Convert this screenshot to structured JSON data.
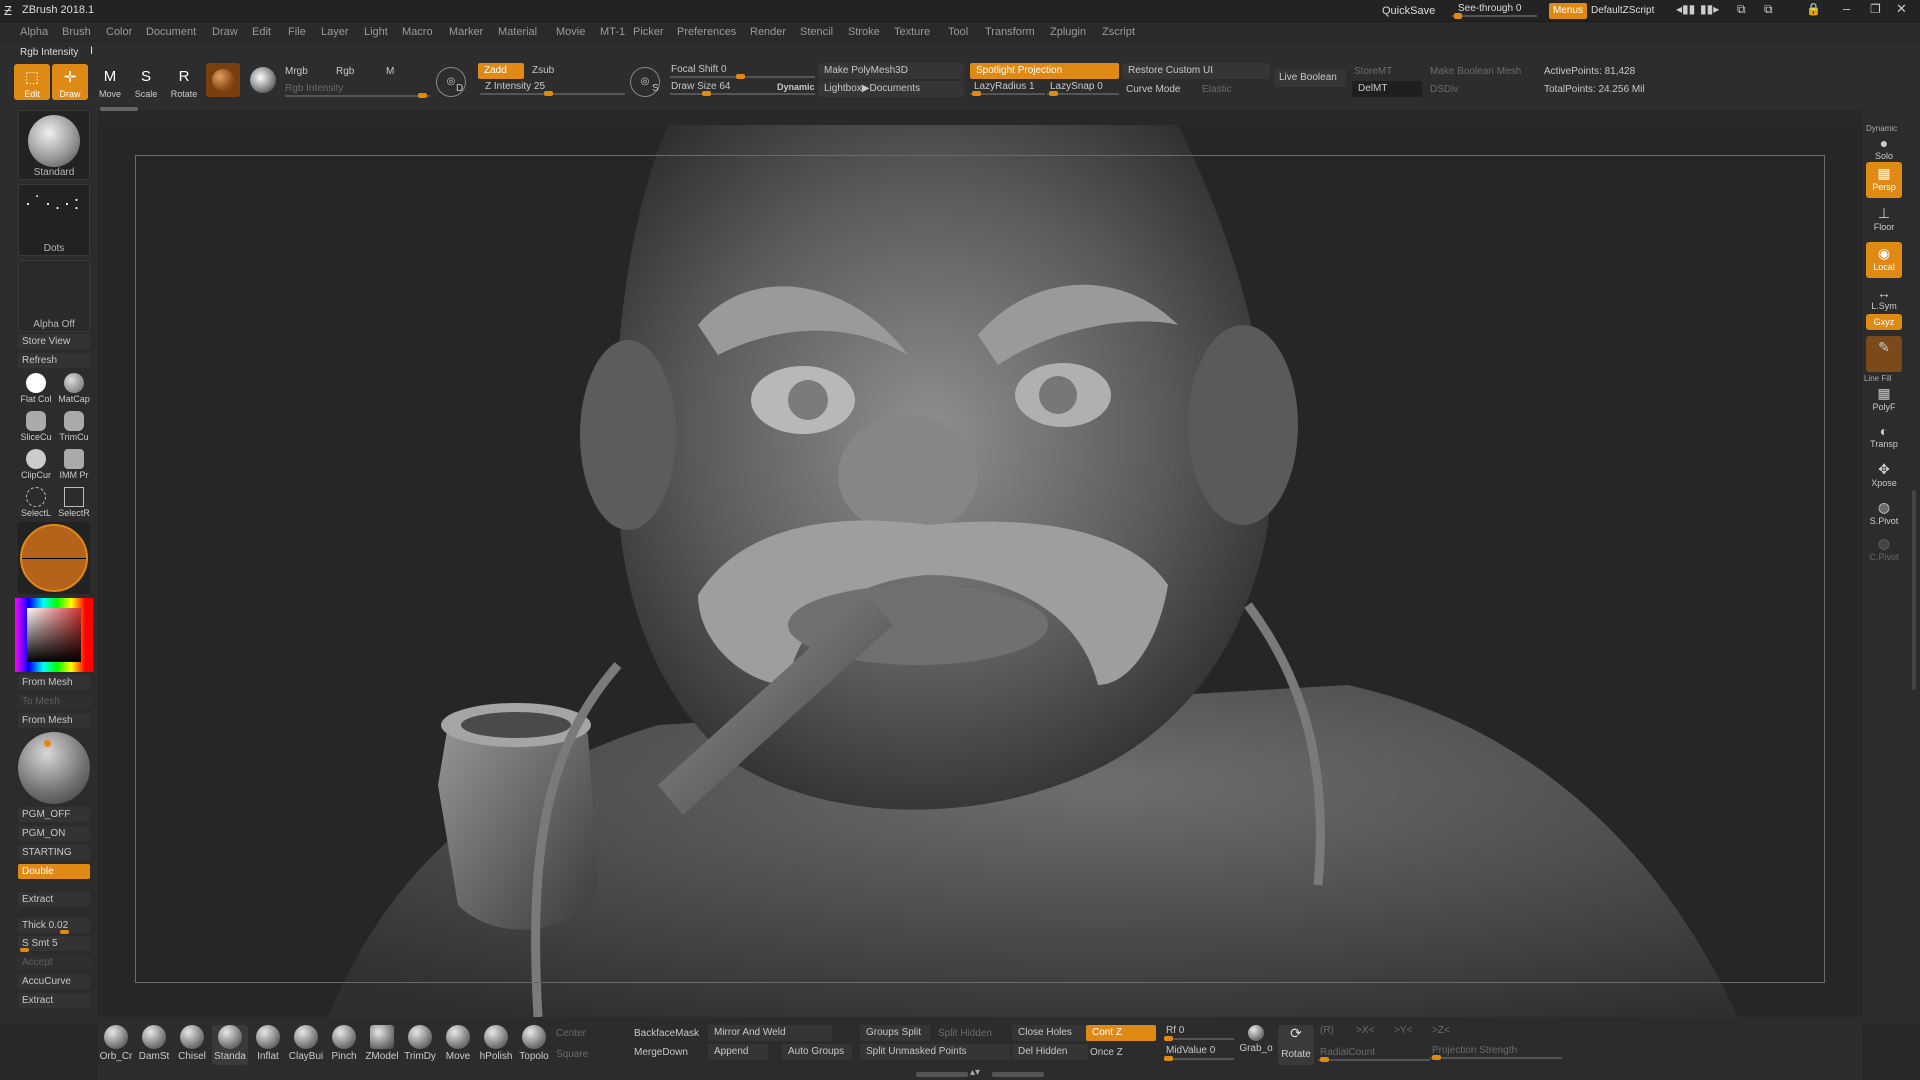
{
  "app": {
    "title": "ZBrush 2018.1"
  },
  "titlebar": {
    "quicksave": "QuickSave",
    "see_through": "See-through   0",
    "menus": "Menus",
    "default_zscript": "DefaultZScript"
  },
  "menu": [
    "Alpha",
    "Brush",
    "Color",
    "Document",
    "Draw",
    "Edit",
    "File",
    "Layer",
    "Light",
    "Macro",
    "Marker",
    "Material",
    "Movie",
    "MT-1",
    "Picker",
    "Preferences",
    "Render",
    "Stencil",
    "Stroke",
    "Texture",
    "Tool",
    "Transform",
    "Zplugin",
    "Zscript"
  ],
  "toolbar": {
    "rgb_intensity_label": "Rgb Intensity",
    "edit": "Edit",
    "draw": "Draw",
    "move": "Move",
    "scale": "Scale",
    "rotate": "Rotate",
    "mrgb": "Mrgb",
    "rgb": "Rgb",
    "m": "M",
    "rgb_intensity": "Rgb Intensity",
    "zadd": "Zadd",
    "zsub": "Zsub",
    "z_intensity": "Z Intensity 25",
    "focal_shift": "Focal Shift 0",
    "draw_size": "Draw Size 64",
    "dynamic": "Dynamic",
    "make_polymesh": "Make PolyMesh3D",
    "lightbox": "Lightbox▶Documents",
    "spotlight": "Spotlight Projection",
    "lazy_radius": "LazyRadius 1",
    "lazy_snap": "LazySnap 0",
    "restore_ui": "Restore Custom UI",
    "curve_mode": "Curve Mode",
    "elastic": "Elastic",
    "live_boolean": "Live Boolean",
    "storemt": "StoreMT",
    "delmt": "DelMT",
    "make_boolean": "Make Boolean Mesh",
    "dsdiv": "DSDiv",
    "active_points": "ActivePoints: 81,428",
    "total_points": "TotalPoints: 24.256 Mil"
  },
  "left": {
    "standard": "Standard",
    "dots": "Dots",
    "alpha_off": "Alpha Off",
    "store_view": "Store View",
    "refresh": "Refresh",
    "flat_col": "Flat Col",
    "matcap": "MatCap",
    "slicecu": "SliceCu",
    "trimcu": "TrimCu",
    "clipcur": "ClipCur",
    "imm_pr": "IMM Pr",
    "selectl": "SelectL",
    "selectr": "SelectR",
    "from_mesh_1": "From Mesh",
    "to_mesh": "To Mesh",
    "from_mesh_2": "From Mesh",
    "pgm_off": "PGM_OFF",
    "pgm_on": "PGM_ON",
    "starting": "STARTING",
    "double": "Double",
    "extract_1": "Extract",
    "thick": "Thick 0.02",
    "s_smt": "S Smt 5",
    "accept": "Accept",
    "accucurve": "AccuCurve",
    "extract_2": "Extract"
  },
  "right": {
    "dynamic": "Dynamic",
    "solo": "Solo",
    "persp": "Persp",
    "floor": "Floor",
    "local": "Local",
    "lsym": "L.Sym",
    "xyz": "Gxyz",
    "polyf": "PolyF",
    "line_fill": "Line Fill",
    "transp": "Transp",
    "xpose": "Xpose",
    "spivot": "S.Pivot",
    "cpivot": "C.Pivot"
  },
  "bottom": {
    "brushes": [
      "Orb_Cr",
      "DamSt",
      "Chisel",
      "Standa",
      "Inflat",
      "ClayBui",
      "Pinch",
      "ZModel",
      "TrimDy",
      "Move",
      "hPolish",
      "Topolo"
    ],
    "center": "Center",
    "square": "Square",
    "backfacemask": "BackfaceMask",
    "mergedown": "MergeDown",
    "mirror_weld": "Mirror And Weld",
    "append": "Append",
    "auto_groups": "Auto Groups",
    "groups_split": "Groups Split",
    "split_hidden": "Split Hidden",
    "split_unmasked": "Split Unmasked Points",
    "close_holes": "Close Holes",
    "del_hidden": "Del Hidden",
    "cont_z": "Cont Z",
    "once_z": "Once Z",
    "rf": "Rf 0",
    "midvalue": "MidValue 0",
    "grab": "Grab_o",
    "rotate": "Rotate",
    "r": "(R)",
    "x": ">X<",
    "y": ">Y<",
    "z": ">Z<",
    "radial_count": "RadialCount",
    "projection_strength": "Projection Strength"
  },
  "colors": {
    "accent": "#e08a16",
    "bg": "#282828"
  }
}
